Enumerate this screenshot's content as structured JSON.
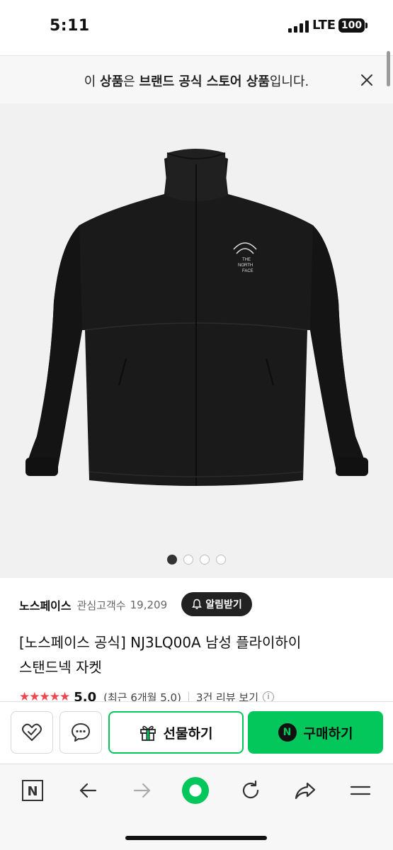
{
  "status_bar": {
    "time": "5:11",
    "network": "LTE",
    "battery": "100"
  },
  "banner": {
    "text_prefix": "이 ",
    "text_bold1": "상품",
    "text_mid1": "은 ",
    "text_bold2": "브랜드 공식 스토어 상품",
    "text_suffix": "입니다."
  },
  "product": {
    "image_alt_icon": "jacket-image",
    "logo_lines": [
      "THE",
      "NORTH",
      "FACE"
    ],
    "image_dots": 4,
    "active_dot": 0,
    "brand": "노스페이스",
    "fan_label": "관심고객수",
    "fan_count": "19,209",
    "alert_label": "알림받기",
    "title_line1": "[노스페이스 공식] NJ3LQ00A 남성 플라이하이",
    "title_line2": "스탠드넥 자켓",
    "rating_stars": 5,
    "rating": "5.0",
    "rating_recent": "(최근 6개월 5.0)",
    "review_link": "3건 리뷰 보기",
    "info_icon": "i"
  },
  "actions": {
    "gift_label": "선물하기",
    "buy_label": "구매하기",
    "npay_mark": "N"
  },
  "browser": {
    "home_logo": "N"
  },
  "colors": {
    "accent_green": "#03c75a",
    "star_red": "#f0464f",
    "dark": "#222222"
  }
}
